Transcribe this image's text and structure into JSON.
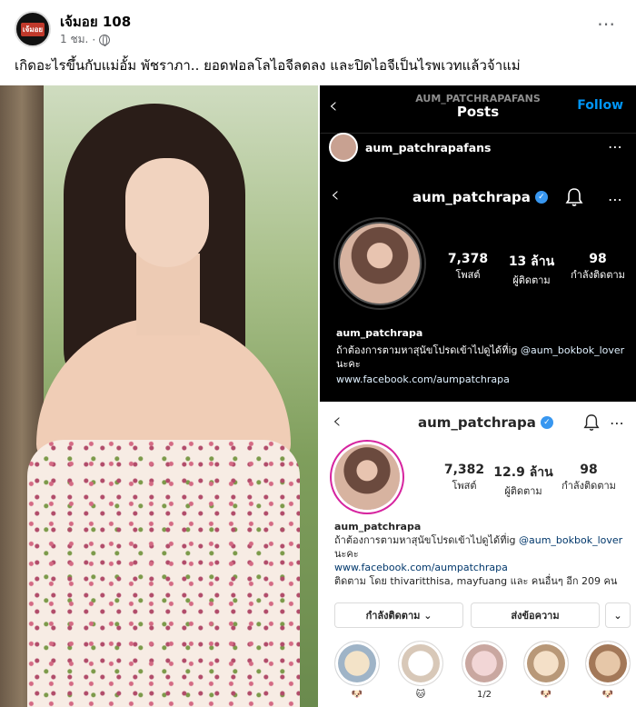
{
  "post": {
    "author": "เจ้มอย 108",
    "time": "1 ชม.",
    "avatar_text": "เจ้มอย",
    "more_icon": "⋯",
    "caption": "เกิดอะไรขึ้นกับแม่อั้ม พัชราภา.. ยอดฟอลโลไอจีลดลง และปิดไอจีเป็นไรพเวทแล้วจ้าแม่"
  },
  "ig_dark": {
    "header_account": "AUM_PATCHRAPAFANS",
    "header_title": "Posts",
    "follow_label": "Follow",
    "post_username": "aum_patchrapafans",
    "profile_username": "aum_patchrapa",
    "stats": [
      {
        "num": "7,378",
        "label": "โพสต์"
      },
      {
        "num": "13 ล้าน",
        "label": "ผู้ติดตาม"
      },
      {
        "num": "98",
        "label": "กำลังติดตาม"
      }
    ],
    "bio_name": "aum_patchrapa",
    "bio_line": "ถ้าต้องการตามหาสุนัขโปรดเข้าไปดูได้ที่ig",
    "bio_mention": "@aum_bokbok_lover",
    "bio_suffix": "นะคะ",
    "bio_link": "www.facebook.com/aumpatchrapa"
  },
  "ig_light": {
    "profile_username": "aum_patchrapa",
    "stats": [
      {
        "num": "7,382",
        "label": "โพสต์"
      },
      {
        "num": "12.9 ล้าน",
        "label": "ผู้ติดตาม"
      },
      {
        "num": "98",
        "label": "กำลังติดตาม"
      }
    ],
    "bio_name": "aum_patchrapa",
    "bio_line": "ถ้าต้องการตามหาสุนัขโปรดเข้าไปดูได้ที่ig",
    "bio_mention": "@aum_bokbok_lover",
    "bio_suffix": "นะคะ",
    "bio_link": "www.facebook.com/aumpatchrapa",
    "followed_by": "ติดตาม โดย thivaritthisa, mayfuang และ คนอื่นๆ อีก 209 คน",
    "following_button": "กำลังติดตาม ⌄",
    "message_button": "ส่งข้อความ",
    "dropdown_button": "⌄",
    "highlights": [
      {
        "label": "🐶"
      },
      {
        "label": "🐱"
      },
      {
        "label": "1/2"
      },
      {
        "label": "🐶"
      },
      {
        "label": "🐶"
      }
    ]
  },
  "colors": {
    "ig_blue": "#0095f6",
    "verified": "#3897f0",
    "fb_meta": "#65676b"
  }
}
